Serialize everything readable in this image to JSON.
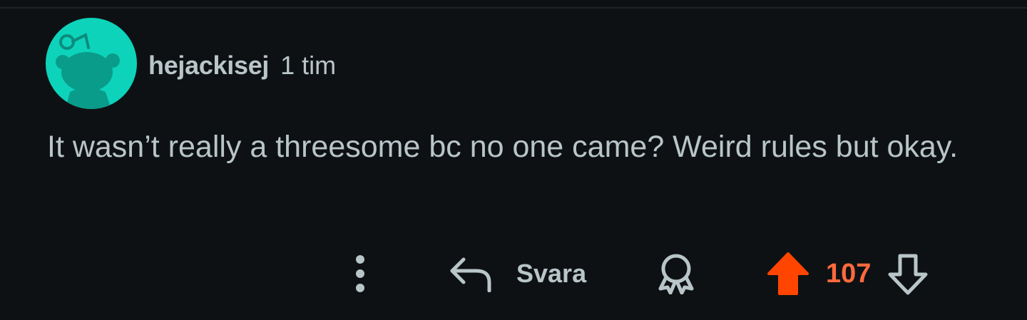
{
  "comment": {
    "username": "hejackisej",
    "timestamp": "1 tim",
    "body": "It wasn’t really a threesome bc no one came? Weird rules but okay.",
    "avatar_color": "#0dd3bb"
  },
  "actions": {
    "more_icon": "more-vertical-icon",
    "reply_icon": "reply-arrow-icon",
    "reply_label": "Svara",
    "award_icon": "award-icon",
    "upvote_icon": "upvote-arrow-icon",
    "score": "107",
    "downvote_icon": "downvote-arrow-icon"
  },
  "colors": {
    "background": "#0e1113",
    "text": "#b8c5c9",
    "upvote_active": "#ff4500",
    "score_active": "#ff6a3d"
  }
}
